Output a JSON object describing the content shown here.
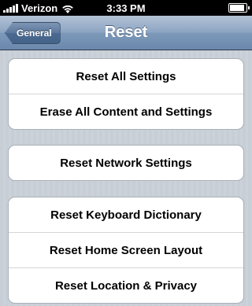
{
  "status_bar": {
    "carrier": "Verizon",
    "time": "3:33 PM"
  },
  "nav": {
    "back_label": "General",
    "title": "Reset"
  },
  "groups": [
    {
      "items": [
        {
          "label": "Reset All Settings"
        },
        {
          "label": "Erase All Content and Settings"
        }
      ]
    },
    {
      "items": [
        {
          "label": "Reset Network Settings"
        }
      ]
    },
    {
      "items": [
        {
          "label": "Reset Keyboard Dictionary"
        },
        {
          "label": "Reset Home Screen Layout"
        },
        {
          "label": "Reset Location & Privacy"
        }
      ]
    }
  ]
}
